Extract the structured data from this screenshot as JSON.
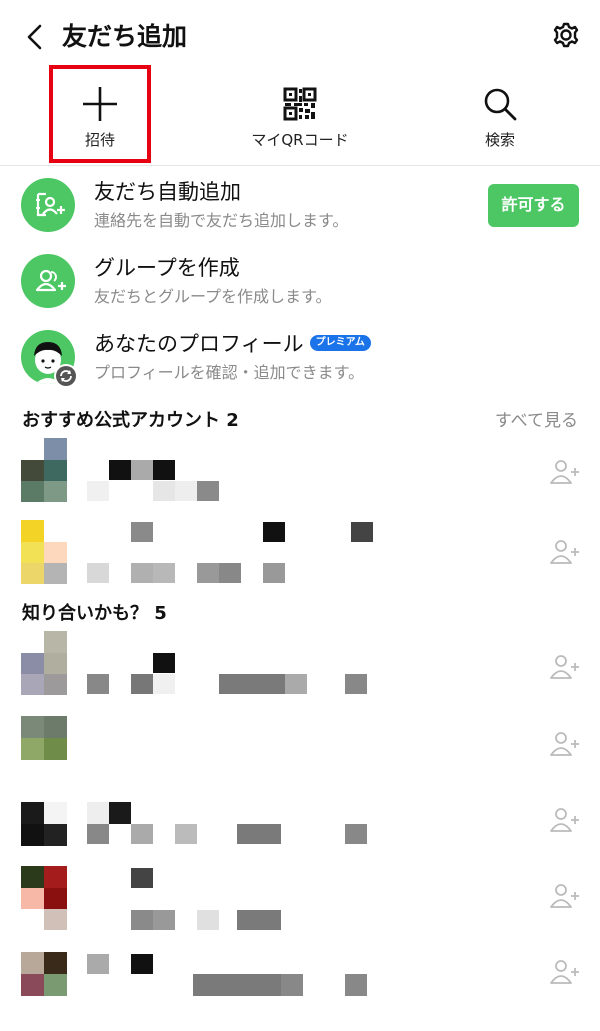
{
  "header": {
    "title": "友だち追加"
  },
  "actions": [
    {
      "label": "招待",
      "icon": "plus-icon"
    },
    {
      "label": "マイQRコード",
      "icon": "qr-code-icon"
    },
    {
      "label": "検索",
      "icon": "search-icon"
    }
  ],
  "features": {
    "auto_add": {
      "title": "友だち自動追加",
      "subtitle": "連絡先を自動で友だち追加します。",
      "button": "許可する"
    },
    "group": {
      "title": "グループを作成",
      "subtitle": "友だちとグループを作成します。"
    },
    "profile": {
      "title": "あなたのプロフィール",
      "badge": "プレミアム",
      "subtitle": "プロフィールを確認・追加できます。"
    }
  },
  "sections": {
    "official": {
      "title": "おすすめ公式アカウント 2",
      "see_all": "すべて見る"
    },
    "suggested": {
      "title": "知り合いかも？ 5"
    }
  },
  "colors": {
    "accent": "#4cc764",
    "highlight": "#e60012",
    "badge": "#1a73e8",
    "subtext": "#8a8a8a"
  }
}
